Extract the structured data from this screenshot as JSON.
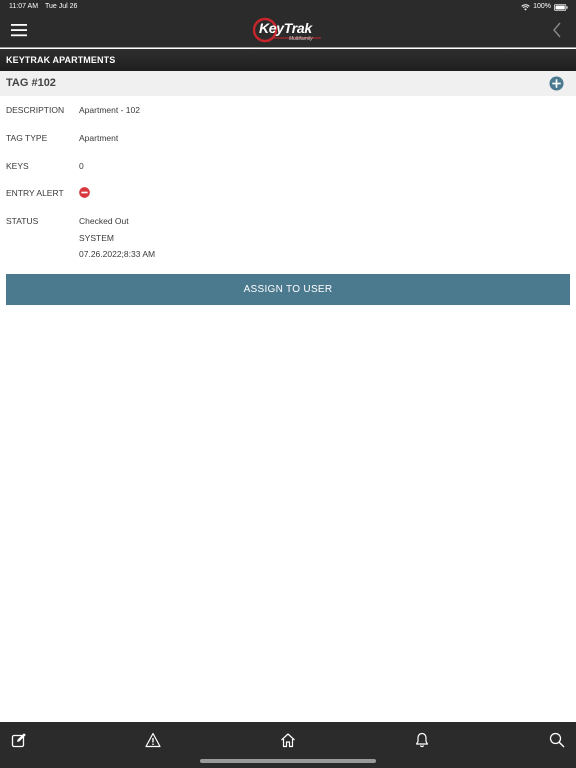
{
  "status_bar": {
    "time": "11:07 AM",
    "date": "Tue Jul 26",
    "battery": "100%"
  },
  "header": {
    "logo_text": "KeyTrak",
    "logo_sub": "Multifamily",
    "property": "KEYTRAK APARTMENTS"
  },
  "tag": {
    "title": "TAG #102",
    "rows": {
      "description": {
        "label": "DESCRIPTION",
        "value": "Apartment - 102"
      },
      "tag_type": {
        "label": "TAG TYPE",
        "value": "Apartment"
      },
      "keys": {
        "label": "KEYS",
        "value": "0"
      },
      "entry_alert": {
        "label": "ENTRY ALERT"
      },
      "status": {
        "label": "STATUS",
        "lines": [
          "Checked Out",
          "SYSTEM",
          "07.26.2022;8:33 AM"
        ]
      }
    }
  },
  "actions": {
    "assign_label": "ASSIGN TO USER"
  },
  "colors": {
    "header_bg": "#2b2b2b",
    "button_bg": "#4b7a8f",
    "add_icon": "#4b7a8f",
    "alert_icon": "#d9363e"
  },
  "icons": {
    "top_left": "menu-icon",
    "top_right": "back-icon",
    "tag_action": "add-icon",
    "entry_alert": "no-entry-icon",
    "bottom_tabs": [
      "edit-icon",
      "warning-icon",
      "home-icon",
      "bell-icon",
      "search-icon"
    ]
  }
}
